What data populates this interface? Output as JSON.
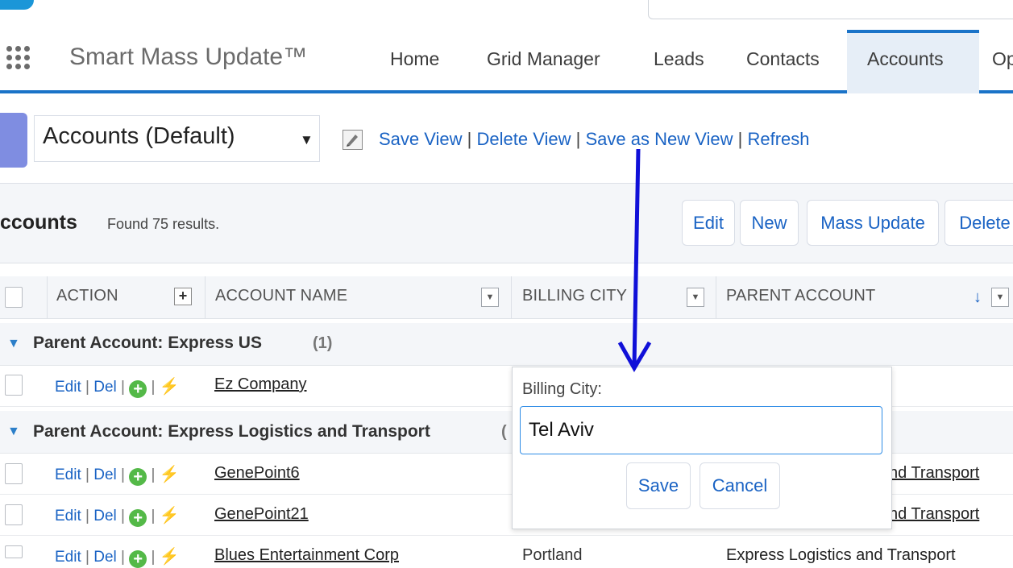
{
  "header": {
    "app_name": "Smart Mass Update™",
    "tabs": [
      {
        "label": "Home"
      },
      {
        "label": "Grid Manager"
      },
      {
        "label": "Leads"
      },
      {
        "label": "Contacts"
      },
      {
        "label": "Accounts",
        "active": true
      },
      {
        "label": "Op"
      }
    ]
  },
  "view_bar": {
    "selected_view": "Accounts (Default)",
    "links": {
      "save_view": "Save View",
      "delete_view": "Delete View",
      "save_as_new_view": "Save as New View",
      "refresh": "Refresh",
      "separator": "|"
    }
  },
  "list_header": {
    "title": "ccounts",
    "found": "Found 75 results.",
    "buttons": {
      "edit": "Edit",
      "new": "New",
      "mass_update": "Mass Update",
      "delete": "Delete"
    }
  },
  "grid": {
    "columns": {
      "action": "ACTION",
      "account_name": "ACCOUNT NAME",
      "billing_city": "BILLING CITY",
      "parent_account": "PARENT ACCOUNT"
    },
    "row_actions": {
      "edit": "Edit",
      "del": "Del",
      "sep": "|"
    },
    "groups": [
      {
        "label": "Parent Account: Express US",
        "count": "(1)",
        "rows": [
          {
            "account_name": "Ez Company",
            "billing_city": "",
            "parent_account": ""
          }
        ]
      },
      {
        "label": "Parent Account: Express Logistics and Transport",
        "count": "(",
        "rows": [
          {
            "account_name": "GenePoint6",
            "billing_city": "",
            "parent_account": "nd Transport"
          },
          {
            "account_name": "GenePoint21",
            "billing_city": "",
            "parent_account": "nd Transport"
          },
          {
            "account_name": "Blues Entertainment Corp",
            "billing_city": "Portland",
            "parent_account": "Express Logistics and Transport"
          }
        ]
      }
    ]
  },
  "popup": {
    "label": "Billing City:",
    "value": "Tel Aviv",
    "save": "Save",
    "cancel": "Cancel"
  },
  "colors": {
    "accent": "#1a73c8",
    "link": "#1a63c4",
    "annotation_arrow": "#1010d8",
    "add_icon": "#54b948"
  }
}
